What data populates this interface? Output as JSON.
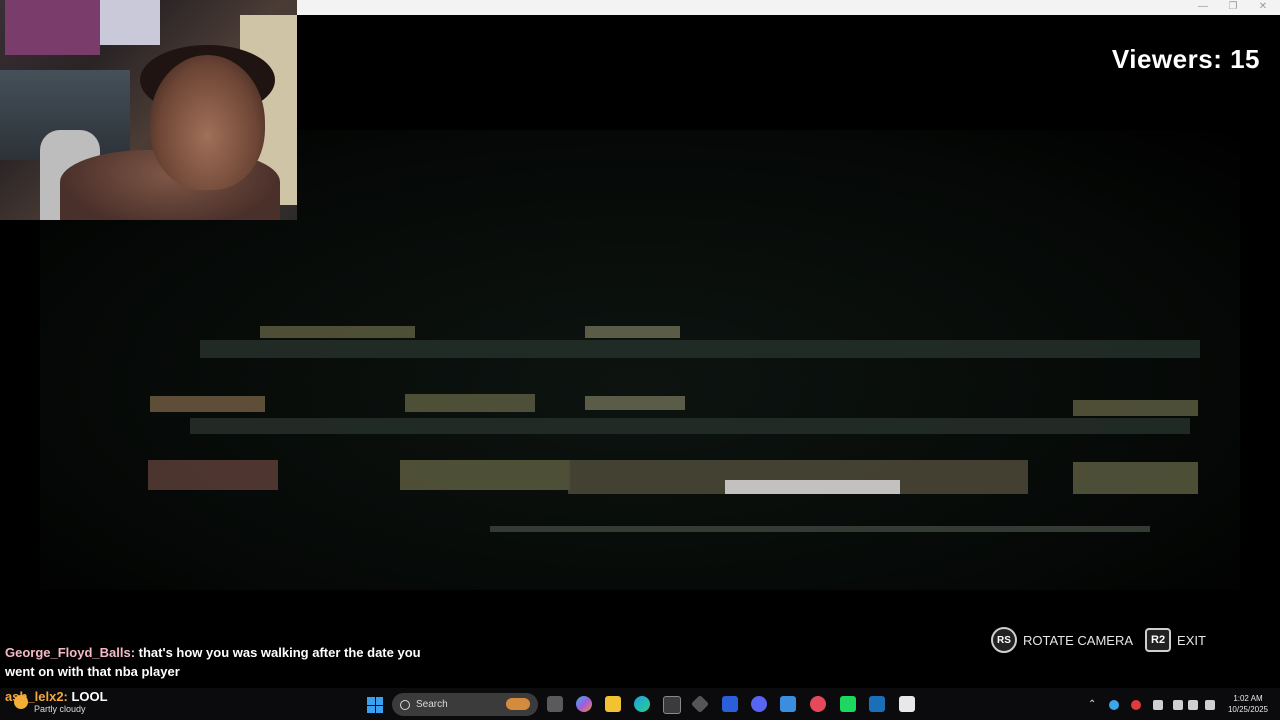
{
  "overlay": {
    "viewers": "Viewers: 15"
  },
  "controls": {
    "rs_glyph": "RS",
    "rotate_label": "ROTATE CAMERA",
    "r2_glyph": "R2",
    "exit_label": "EXIT"
  },
  "chat": {
    "messages": [
      {
        "user": "George_Floyd_Balls:",
        "text": " that's how you was walking after the date you went on with that nba player"
      },
      {
        "user": "ash_lelx2:",
        "text": " LOOL"
      }
    ]
  },
  "taskbar": {
    "weather_text": "Partly cloudy",
    "search_label": "Search",
    "time": "1:02 AM",
    "date": "10/25/2025"
  },
  "icons": {
    "window_minimize": "minimize-icon",
    "window_restore": "restore-icon",
    "window_close": "close-icon"
  }
}
